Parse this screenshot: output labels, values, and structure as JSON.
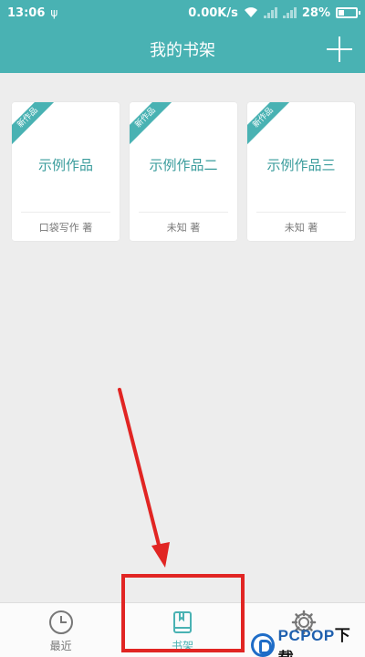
{
  "status_bar": {
    "time": "13:06",
    "usb_glyph": "ψ",
    "net_speed": "0.00K/s",
    "battery": "28%",
    "battery_level": 0.28,
    "icons": [
      "usb-icon",
      "wifi-icon",
      "signal-icon",
      "signal-icon",
      "battery-icon"
    ]
  },
  "app_bar": {
    "title": "我的书架",
    "add_icon": "plus-icon"
  },
  "books": [
    {
      "badge": "新作品",
      "title": "示例作品",
      "author": "口袋写作 著"
    },
    {
      "badge": "新作品",
      "title": "示例作品二",
      "author": "未知 著"
    },
    {
      "badge": "新作品",
      "title": "示例作品三",
      "author": "未知 著"
    }
  ],
  "bottom_nav": {
    "items": [
      {
        "label": "最近",
        "icon": "clock-icon",
        "active": false
      },
      {
        "label": "书架",
        "icon": "bookshelf-icon",
        "active": true
      },
      {
        "label": "",
        "icon": "gear-icon",
        "active": false
      }
    ]
  },
  "watermark": {
    "text": "PCPOP",
    "suffix": "下载"
  },
  "colors": {
    "accent": "#49b2b3",
    "background": "#ededed",
    "annotation": "#e12523",
    "watermark": "#1e5fae"
  }
}
